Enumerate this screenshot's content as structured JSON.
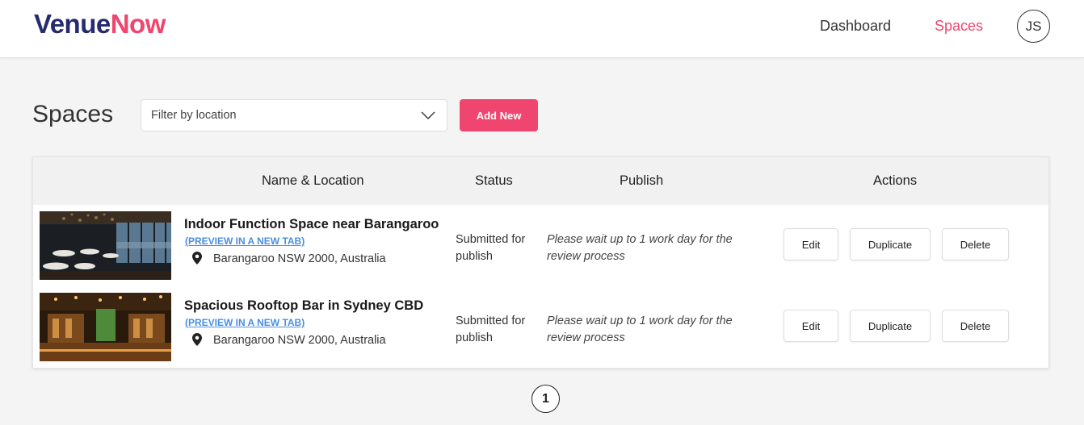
{
  "header": {
    "logo_part1": "Venue",
    "logo_part2": "Now",
    "nav": {
      "dashboard": "Dashboard",
      "spaces": "Spaces"
    },
    "avatar_initials": "JS",
    "accent_color": "#f0456e",
    "brand_color": "#262a6e"
  },
  "toolbar": {
    "page_title": "Spaces",
    "filter_placeholder": "Filter by location",
    "add_label": "Add New"
  },
  "table": {
    "columns": {
      "name_location": "Name & Location",
      "status": "Status",
      "publish": "Publish",
      "actions": "Actions"
    },
    "rows": [
      {
        "name": "Indoor Function Space near Barangaroo",
        "preview": "(PREVIEW IN A NEW TAB)",
        "location": "Barangaroo NSW 2000, Australia",
        "status": "Submitted for publish",
        "publish": "Please wait up to 1 work day for the review process",
        "actions": {
          "edit": "Edit",
          "duplicate": "Duplicate",
          "delete": "Delete"
        }
      },
      {
        "name": "Spacious Rooftop Bar in Sydney CBD",
        "preview": "(PREVIEW IN A NEW TAB)",
        "location": "Barangaroo NSW 2000, Australia",
        "status": "Submitted for publish",
        "publish": "Please wait up to 1 work day for the review process",
        "actions": {
          "edit": "Edit",
          "duplicate": "Duplicate",
          "delete": "Delete"
        }
      }
    ]
  },
  "pagination": {
    "current_page": "1"
  }
}
